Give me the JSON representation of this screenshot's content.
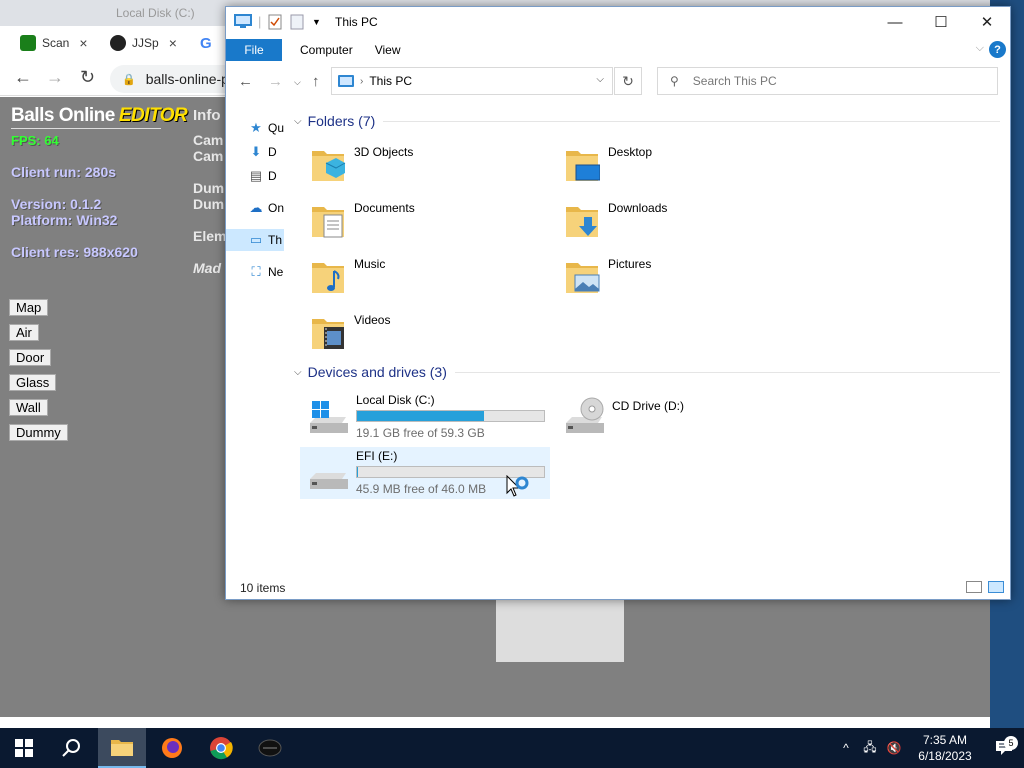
{
  "chrome": {
    "ghost_title": "Local Disk (C:)",
    "tabs": [
      {
        "label": "Scan",
        "favicon_color": "#1a7f1a",
        "close": "×"
      },
      {
        "label": "JJSp",
        "favicon_color": "#222222",
        "close": "×"
      },
      {
        "label": "G",
        "favicon_color": "#ffffff",
        "close": ""
      }
    ],
    "omnibox_text": "balls-online-p",
    "back_icon": "←",
    "forward_icon": "→",
    "reload_icon": "↻",
    "lock_icon": "🔒"
  },
  "game": {
    "title": "Balls Online",
    "title_accent": "EDITOR",
    "fps": "FPS: 64",
    "client_run": "Client run: 280s",
    "version": "Version: 0.1.2",
    "platform": "Platform: Win32",
    "client_res": "Client res: 988x620",
    "info_lines": [
      "Info",
      "Cam",
      "Cam",
      "Dum",
      "Dum",
      "Elem",
      "Mad"
    ],
    "buttons": [
      "Map",
      "Air",
      "Door",
      "Glass",
      "Wall",
      "Dummy"
    ]
  },
  "explorer": {
    "title": "This PC",
    "window_controls": {
      "minimize": "—",
      "maximize": "☐",
      "close": "✕"
    },
    "ribbon_tabs": [
      "File",
      "Computer",
      "View"
    ],
    "help": "?",
    "expand_ribbon": "⌵",
    "address": "This PC",
    "search_placeholder": "Search This PC",
    "nav_pane": [
      {
        "label": "Qu",
        "icon": "★",
        "color": "#2e86d1"
      },
      {
        "label": "D",
        "icon": "⬇",
        "color": "#2e86d1"
      },
      {
        "label": "D",
        "icon": "▤",
        "color": "#555555"
      },
      {
        "label": "On",
        "icon": "☁",
        "color": "#1e6fc5"
      },
      {
        "label": "Th",
        "icon": "▭",
        "color": "#2e86d1"
      },
      {
        "label": "Ne",
        "icon": "⛶",
        "color": "#2e86d1"
      }
    ],
    "folders_header": "Folders (7)",
    "folders": [
      {
        "name": "3D Objects",
        "icon": "3d-objects-folder-icon",
        "accent": "#3bb3e0"
      },
      {
        "name": "Desktop",
        "icon": "desktop-folder-icon",
        "accent": "#1e7fd8"
      },
      {
        "name": "Documents",
        "icon": "documents-folder-icon",
        "accent": "#888888"
      },
      {
        "name": "Downloads",
        "icon": "downloads-folder-icon",
        "accent": "#2e86d1"
      },
      {
        "name": "Music",
        "icon": "music-folder-icon",
        "accent": "#1e6fc5"
      },
      {
        "name": "Pictures",
        "icon": "pictures-folder-icon",
        "accent": "#4a7fb5"
      },
      {
        "name": "Videos",
        "icon": "videos-folder-icon",
        "accent": "#333333"
      }
    ],
    "drives_header": "Devices and drives (3)",
    "drives": [
      {
        "name": "Local Disk (C:)",
        "free_text": "19.1 GB free of 59.3 GB",
        "used_fraction": 0.678,
        "has_bar": true,
        "icon": "windows-drive-icon"
      },
      {
        "name": "CD Drive (D:)",
        "free_text": "",
        "used_fraction": 0,
        "has_bar": false,
        "icon": "cd-drive-icon"
      },
      {
        "name": "EFI (E:)",
        "free_text": "45.9 MB free of 46.0 MB",
        "used_fraction": 0.002,
        "has_bar": true,
        "icon": "drive-icon"
      }
    ],
    "status": "10 items"
  },
  "taskbar": {
    "start_icon": "windows-logo-icon",
    "search_icon": "search-icon",
    "time": "7:35 AM",
    "date": "6/18/2023",
    "notification_count": "5",
    "tray_icons": [
      "^",
      "🖧",
      "🔇"
    ]
  }
}
